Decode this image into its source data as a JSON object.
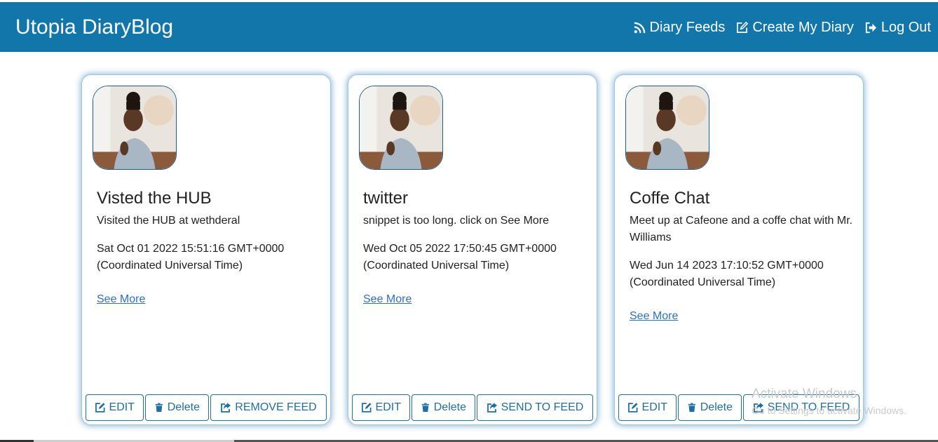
{
  "header": {
    "brand": "Utopia DiaryBlog",
    "links": [
      {
        "label": "Diary Feeds",
        "icon": "rss-icon"
      },
      {
        "label": "Create My Diary",
        "icon": "edit-icon"
      },
      {
        "label": "Log Out",
        "icon": "logout-icon"
      }
    ]
  },
  "cards": [
    {
      "title": "Visted the HUB",
      "snippet": "Visited the HUB at wethderal",
      "date": "Sat Oct 01 2022 15:51:16 GMT+0000 (Coordinated Universal Time)",
      "see_more": "See More",
      "edit_label": "EDIT",
      "delete_label": "Delete",
      "feed_label": "REMOVE FEED"
    },
    {
      "title": "twitter",
      "snippet": "snippet is too long. click on See More",
      "date": "Wed Oct 05 2022 17:50:45 GMT+0000 (Coordinated Universal Time)",
      "see_more": "See More",
      "edit_label": "EDIT",
      "delete_label": "Delete",
      "feed_label": "SEND TO FEED"
    },
    {
      "title": "Coffe Chat",
      "snippet": "Meet up at Cafeone and a coffe chat with Mr. Williams",
      "date": "Wed Jun 14 2023 17:10:52 GMT+0000 (Coordinated Universal Time)",
      "see_more": "See More",
      "edit_label": "EDIT",
      "delete_label": "Delete",
      "feed_label": "SEND TO FEED"
    }
  ],
  "watermark": {
    "title": "Activate Windows",
    "subtitle": "Go to Settings to activate Windows."
  },
  "colors": {
    "navbar": "#1276ab",
    "button_accent": "#1d6fa5",
    "link": "#2a6fd0"
  }
}
